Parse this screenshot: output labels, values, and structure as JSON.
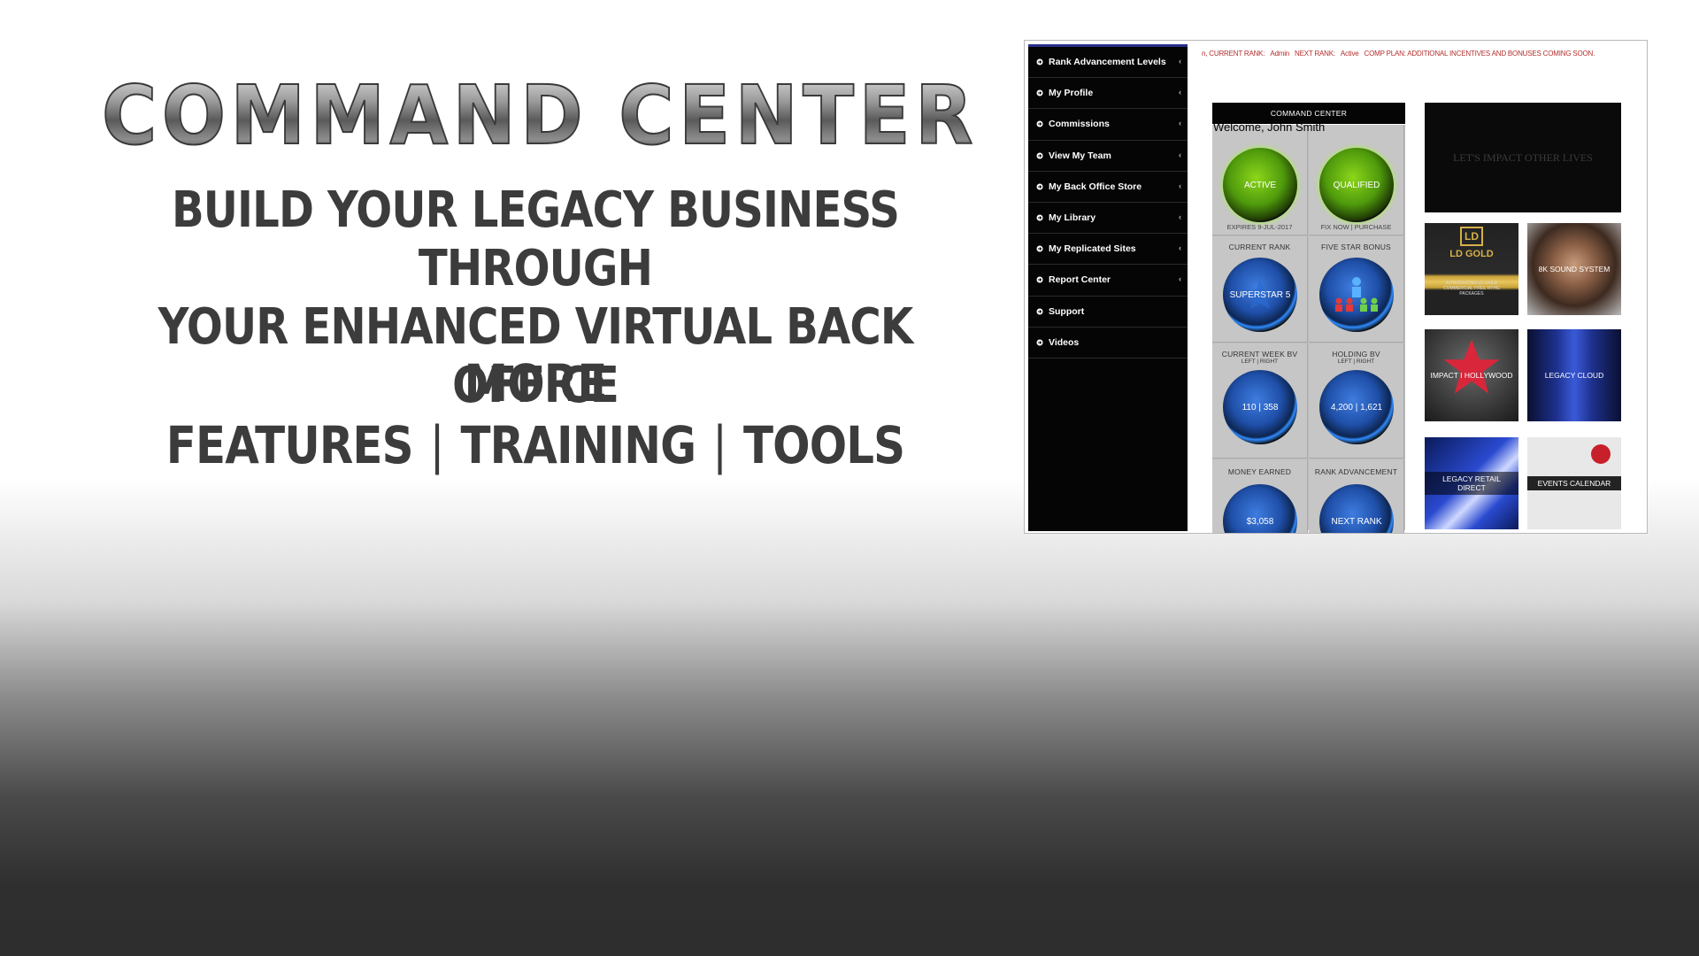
{
  "hero": {
    "title": "COMMAND  CENTER",
    "tagline_line1": "BUILD YOUR LEGACY BUSINESS THROUGH",
    "tagline_line2": "YOUR ENHANCED VIRTUAL BACK OFFICE",
    "features": [
      "MORE FEATURES",
      "TRAINING",
      "TOOLS"
    ],
    "separator": "|"
  },
  "panel": {
    "topbar": {
      "name_tail": "n, CURRENT RANK:",
      "rank": "Admin",
      "next_rank_label": "NEXT RANK:",
      "next_rank": "Active",
      "comp_plan": "COMP PLAN: ADDITIONAL INCENTIVES AND BONUSES COMING SOON."
    },
    "sidebar": {
      "items": [
        {
          "label": "Rank Advancement Levels",
          "chevron": "‹"
        },
        {
          "label": "My Profile",
          "chevron": "‹"
        },
        {
          "label": "Commissions",
          "chevron": "‹"
        },
        {
          "label": "View My Team",
          "chevron": "‹"
        },
        {
          "label": "My Back Office Store",
          "chevron": "‹"
        },
        {
          "label": "My Library",
          "chevron": "‹"
        },
        {
          "label": "My Replicated Sites",
          "chevron": "‹"
        },
        {
          "label": "Report Center",
          "chevron": "‹"
        },
        {
          "label": "Support",
          "chevron": ""
        },
        {
          "label": "Videos",
          "chevron": ""
        }
      ]
    },
    "command_center": {
      "header": "COMMAND CENTER",
      "welcome": "Welcome, John Smith",
      "cells": [
        {
          "label": "",
          "sub": "",
          "orb": "ACTIVE",
          "foot": "EXPIRES 9-JUL-2017",
          "color": "green"
        },
        {
          "label": "",
          "sub": "",
          "orb": "QUALIFIED",
          "foot": "FIX NOW | PURCHASE",
          "color": "green"
        },
        {
          "label": "CURRENT RANK",
          "sub": "",
          "orb": "SUPERSTAR 5",
          "foot": "",
          "color": "blue"
        },
        {
          "label": "FIVE STAR BONUS",
          "sub": "",
          "orb": "",
          "foot": "",
          "color": "blue"
        },
        {
          "label": "CURRENT WEEK BV",
          "sub": "LEFT | RIGHT",
          "orb": "110 | 358",
          "foot": "",
          "color": "blue"
        },
        {
          "label": "HOLDING BV",
          "sub": "LEFT | RIGHT",
          "orb": "4,200 | 1,621",
          "foot": "",
          "color": "blue"
        },
        {
          "label": "MONEY EARNED",
          "sub": "",
          "orb": "$3,058",
          "foot": "",
          "color": "blue"
        },
        {
          "label": "RANK ADVANCEMENT",
          "sub": "",
          "orb": "NEXT RANK",
          "foot": "",
          "color": "blue"
        }
      ]
    },
    "banner": "LET'S IMPACT OTHER LIVES",
    "tiles": [
      {
        "label": "LD GOLD",
        "sub": "INTRODUCING LD GOLD COMMERCIAL FREE RTHG PACKAGES"
      },
      {
        "label": "8K SOUND SYSTEM",
        "sub": ""
      },
      {
        "label": "IMPACT I HOLLYWOOD",
        "sub": ""
      },
      {
        "label": "LEGACY CLOUD",
        "sub": ""
      },
      {
        "label": "LEGACY RETAIL DIRECT",
        "sub": ""
      },
      {
        "label": "EVENTS CALENDAR",
        "sub": ""
      }
    ],
    "colors": {
      "topbar_text": "#b52e2e",
      "sidebar_bg": "#050505",
      "orb_green": "#8cd61a",
      "orb_blue": "#2f8cff"
    }
  }
}
